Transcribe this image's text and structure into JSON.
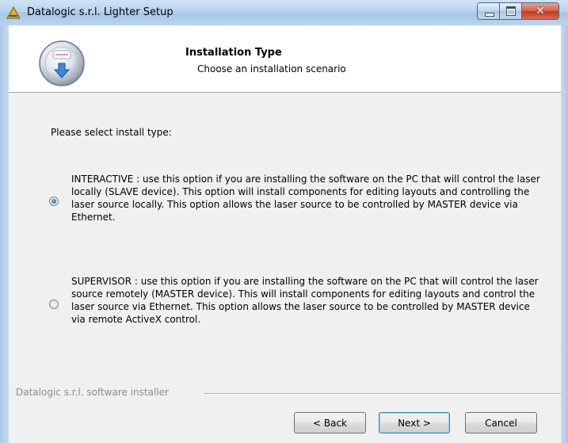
{
  "window": {
    "title": "Datalogic s.r.l. Lighter Setup",
    "controls": [
      "minimize",
      "maximize",
      "close"
    ]
  },
  "header": {
    "title": "Installation Type",
    "subtitle": "Choose an installation scenario",
    "icon": "installer-disc-icon"
  },
  "main": {
    "prompt": "Please select install type:",
    "options": [
      {
        "selected": true,
        "text": "INTERACTIVE : use this option if you are installing the software on the PC that will control the laser locally (SLAVE device). This option will install components for editing layouts and controlling the laser source locally. This option allows the laser source to be controlled by MASTER device via Ethernet."
      },
      {
        "selected": false,
        "text": "SUPERVISOR : use this option if you are installing the software on the PC that will control the laser source remotely (MASTER device). This will install components for editing layouts and control the laser source via Ethernet. This option allows the laser source to be controlled by MASTER device via remote ActiveX control."
      }
    ]
  },
  "footer": {
    "branding": "Datalogic s.r.l. software installer",
    "back_label": "< Back",
    "next_label": "Next >",
    "cancel_label": "Cancel"
  }
}
